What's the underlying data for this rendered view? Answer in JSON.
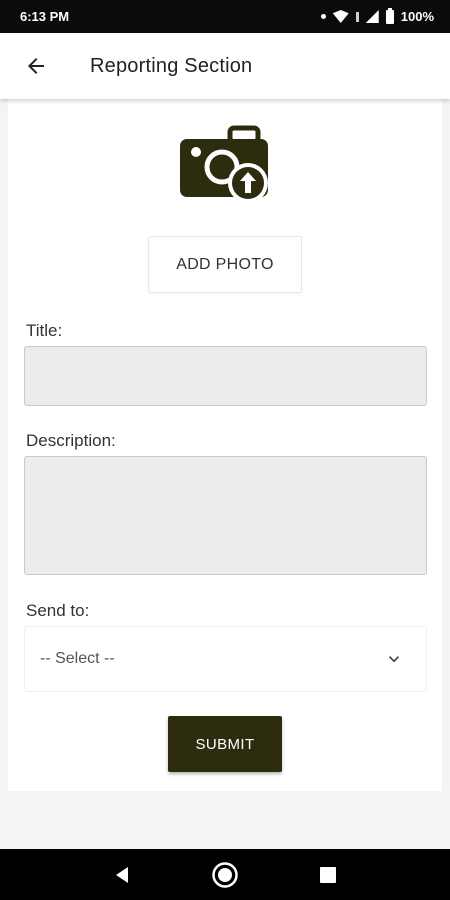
{
  "status_bar": {
    "time": "6:13 PM",
    "battery": "100%"
  },
  "header": {
    "title": "Reporting Section",
    "back_icon": "arrow-left-icon"
  },
  "photo": {
    "icon": "camera-upload-icon",
    "button_label": "ADD PHOTO"
  },
  "form": {
    "title_label": "Title:",
    "title_value": "",
    "description_label": "Description:",
    "description_value": "",
    "send_to_label": "Send to:",
    "send_to_selected": "-- Select --",
    "submit_label": "SUBMIT"
  },
  "colors": {
    "accent": "#2e2c0f",
    "input_bg": "#ececec"
  },
  "nav": {
    "back": "triangle-back-icon",
    "home": "circle-home-icon",
    "recents": "square-recents-icon"
  }
}
